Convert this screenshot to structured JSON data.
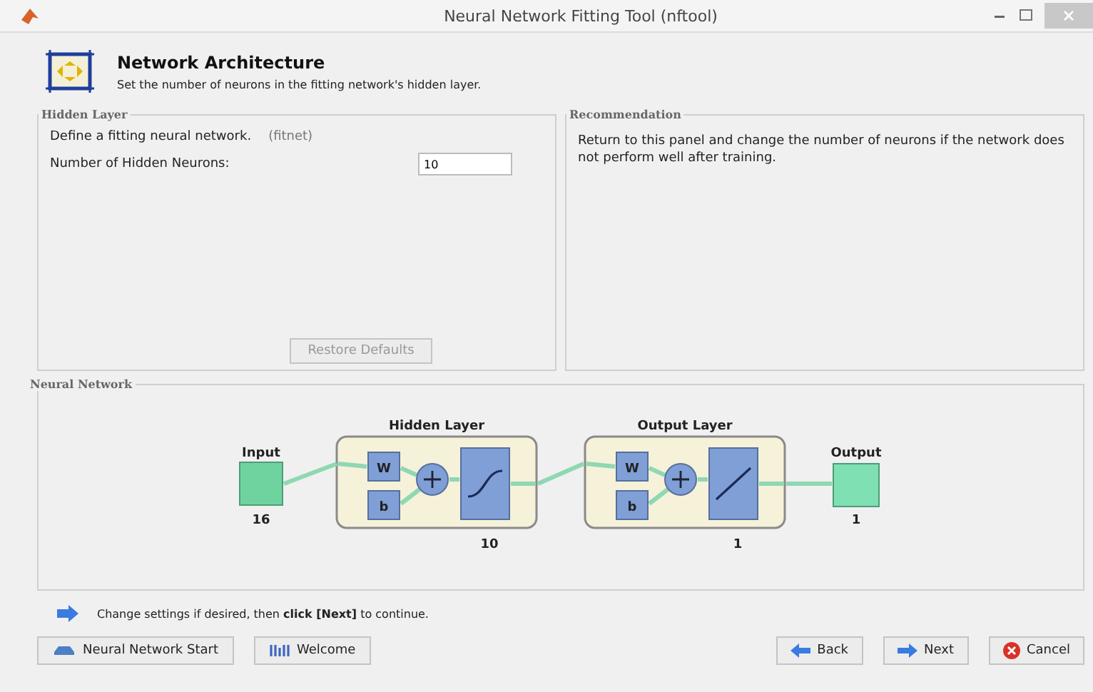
{
  "window": {
    "title": "Neural Network Fitting Tool (nftool)"
  },
  "header": {
    "title": "Network Architecture",
    "subtitle": "Set the number of neurons in the fitting network's hidden layer."
  },
  "hidden_layer_panel": {
    "title": "Hidden Layer",
    "description": "Define a fitting neural network.",
    "function": "(fitnet)",
    "neurons_label": "Number of Hidden Neurons:",
    "neurons_value": "10",
    "restore_button": {
      "label": "Restore Defaults",
      "disabled": true
    }
  },
  "recommendation_panel": {
    "title": "Recommendation",
    "text": "Return to this panel and change the number of neurons if the network does not perform well after training."
  },
  "network_panel": {
    "title": "Neural Network",
    "diagram": {
      "input": {
        "label": "Input",
        "size": "16"
      },
      "layers": [
        {
          "title": "Hidden Layer",
          "weight": "W",
          "bias": "b",
          "kind": "sigmoid",
          "size": "10"
        },
        {
          "title": "Output Layer",
          "weight": "W",
          "bias": "b",
          "kind": "linear",
          "size": "1"
        }
      ],
      "output": {
        "label": "Output",
        "size": "1"
      }
    }
  },
  "hint": "Change settings  if desired, then **click [Next]** to continue.",
  "nav_buttons": [
    {
      "label": "Neural Network Start",
      "kind": "start"
    },
    {
      "label": "Welcome",
      "kind": "welcome"
    }
  ],
  "wizard_buttons": [
    {
      "label": "Back",
      "kind": "back"
    },
    {
      "label": "Next",
      "kind": "next"
    },
    {
      "label": "Cancel",
      "kind": "cancel"
    }
  ]
}
